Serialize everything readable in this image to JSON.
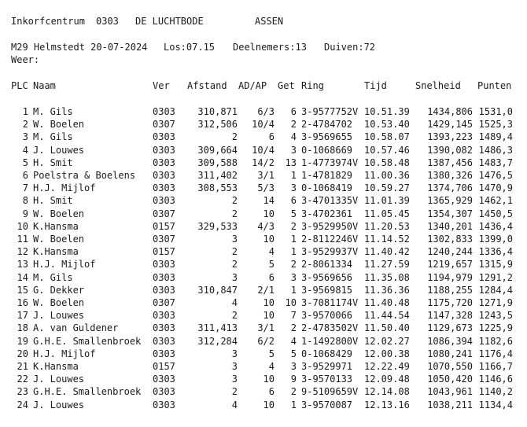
{
  "header": {
    "centrum_label": "Inkorfcentrum",
    "centrum_code": "0303",
    "club_name": "DE LUCHTBODE",
    "city": "ASSEN"
  },
  "race": {
    "race_name": "M29 Helmstedt 20-07-2024",
    "release": "Los:07.15",
    "participants": "Deelnemers:13",
    "pigeons": "Duiven:72",
    "weather": "Weer:"
  },
  "columns": [
    "PLC",
    "Naam",
    "Ver",
    "Afstand",
    "AD/AP",
    "Get",
    "Ring",
    "Tijd",
    "Snelheid",
    "Punten"
  ],
  "rows": [
    [
      "1",
      "M. Gils",
      "0303",
      "310,871",
      "6/3",
      "6",
      "3-9577752V",
      "10.51.39",
      "1434,806",
      "1531,0"
    ],
    [
      "2",
      "W. Boelen",
      "0307",
      "312,506",
      "10/4",
      "2",
      "2-4784702",
      "10.53.40",
      "1429,145",
      "1525,3"
    ],
    [
      "3",
      "M. Gils",
      "0303",
      "2",
      "6",
      "4",
      "3-9569655",
      "10.58.07",
      "1393,223",
      "1489,4"
    ],
    [
      "4",
      "J. Louwes",
      "0303",
      "309,664",
      "10/4",
      "3",
      "0-1068669",
      "10.57.46",
      "1390,082",
      "1486,3"
    ],
    [
      "5",
      "H. Smit",
      "0303",
      "309,588",
      "14/2",
      "13",
      "1-4773974V",
      "10.58.48",
      "1387,456",
      "1483,7"
    ],
    [
      "6",
      "Poelstra & Boelens",
      "0303",
      "311,402",
      "3/1",
      "1",
      "1-4781829",
      "11.00.36",
      "1380,326",
      "1476,5"
    ],
    [
      "7",
      "H.J. Mijlof",
      "0303",
      "308,553",
      "5/3",
      "3",
      "0-1068419",
      "10.59.27",
      "1374,706",
      "1470,9"
    ],
    [
      "8",
      "H. Smit",
      "0303",
      "2",
      "14",
      "6",
      "3-4701335V",
      "11.01.39",
      "1365,929",
      "1462,1"
    ],
    [
      "9",
      "W. Boelen",
      "0307",
      "2",
      "10",
      "5",
      "3-4702361",
      "11.05.45",
      "1354,307",
      "1450,5"
    ],
    [
      "10",
      "K.Hansma",
      "0157",
      "329,533",
      "4/3",
      "2",
      "3-9529950V",
      "11.20.53",
      "1340,201",
      "1436,4"
    ],
    [
      "11",
      "W. Boelen",
      "0307",
      "3",
      "10",
      "1",
      "2-8112246V",
      "11.14.52",
      "1302,833",
      "1399,0"
    ],
    [
      "12",
      "K.Hansma",
      "0157",
      "2",
      "4",
      "1",
      "3-9529937V",
      "11.40.42",
      "1240,244",
      "1336,4"
    ],
    [
      "13",
      "H.J. Mijlof",
      "0303",
      "2",
      "5",
      "2",
      "2-8061334",
      "11.27.59",
      "1219,657",
      "1315,9"
    ],
    [
      "14",
      "M. Gils",
      "0303",
      "3",
      "6",
      "3",
      "3-9569656",
      "11.35.08",
      "1194,979",
      "1291,2"
    ],
    [
      "15",
      "G. Dekker",
      "0303",
      "310,847",
      "2/1",
      "1",
      "3-9569815",
      "11.36.36",
      "1188,255",
      "1284,4"
    ],
    [
      "16",
      "W. Boelen",
      "0307",
      "4",
      "10",
      "10",
      "3-7081174V",
      "11.40.48",
      "1175,720",
      "1271,9"
    ],
    [
      "17",
      "J. Louwes",
      "0303",
      "2",
      "10",
      "7",
      "3-9570066",
      "11.44.54",
      "1147,328",
      "1243,5"
    ],
    [
      "18",
      "A. van Guldener",
      "0303",
      "311,413",
      "3/1",
      "2",
      "2-4783502V",
      "11.50.40",
      "1129,673",
      "1225,9"
    ],
    [
      "19",
      "G.H.E. Smallenbroek",
      "0303",
      "312,284",
      "6/2",
      "4",
      "1-1492800V",
      "12.02.27",
      "1086,394",
      "1182,6"
    ],
    [
      "20",
      "H.J. Mijlof",
      "0303",
      "3",
      "5",
      "5",
      "0-1068429",
      "12.00.38",
      "1080,241",
      "1176,4"
    ],
    [
      "21",
      "K.Hansma",
      "0157",
      "3",
      "4",
      "3",
      "3-9529971",
      "12.22.49",
      "1070,550",
      "1166,7"
    ],
    [
      "22",
      "J. Louwes",
      "0303",
      "3",
      "10",
      "9",
      "3-9570133",
      "12.09.48",
      "1050,420",
      "1146,6"
    ],
    [
      "23",
      "G.H.E. Smallenbroek",
      "0303",
      "2",
      "6",
      "2",
      "9-5109659V",
      "12.14.08",
      "1043,961",
      "1140,2"
    ],
    [
      "24",
      "J. Louwes",
      "0303",
      "4",
      "10",
      "1",
      "3-9570087",
      "12.13.16",
      "1038,211",
      "1134,4"
    ]
  ]
}
